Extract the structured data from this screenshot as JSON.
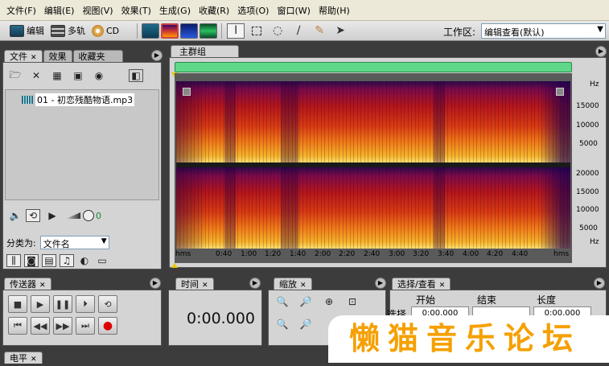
{
  "menu": [
    "文件(F)",
    "编辑(E)",
    "视图(V)",
    "效果(T)",
    "生成(G)",
    "收藏(R)",
    "选项(O)",
    "窗口(W)",
    "帮助(H)"
  ],
  "toolbar": {
    "edit_label": "编辑",
    "multitrack_label": "多轨",
    "cd_label": "CD",
    "workspace_label": "工作区:",
    "workspace_value": "编辑查看(默认)"
  },
  "left_panel": {
    "tabs": [
      "文件",
      "效果",
      "收藏夹"
    ],
    "file_item": "01 - 初恋残酷物语.mp3",
    "volume_value": "0",
    "sort_label": "分类为:",
    "sort_value": "文件名"
  },
  "main_panel": {
    "tab": "主群组",
    "freq_unit": "Hz",
    "freq_top": [
      "15000",
      "10000",
      "5000"
    ],
    "freq_bottom": [
      "20000",
      "15000",
      "10000",
      "5000"
    ],
    "time_unit": "hms",
    "time_ticks": [
      "0:40",
      "1:00",
      "1:20",
      "1:40",
      "2:00",
      "2:20",
      "2:40",
      "3:00",
      "3:20",
      "3:40",
      "4:00",
      "4:20",
      "4:40"
    ],
    "time_unit_end": "hms"
  },
  "transport": {
    "tab": "传送器"
  },
  "time_panel": {
    "tab": "时间",
    "value": "0:00.000"
  },
  "zoom_panel": {
    "tab": "缩放"
  },
  "selection_panel": {
    "tab": "选择/查看",
    "col_start": "开始",
    "col_end": "结束",
    "col_length": "长度",
    "row_label": "选择",
    "start_value": "0:00.000",
    "length_value": "0:00.000"
  },
  "level_panel": {
    "tab": "电平"
  },
  "watermark": "懒猫音乐论坛",
  "colors": {
    "overview_bar": "#5fd88a",
    "watermark": "#f5a000"
  }
}
